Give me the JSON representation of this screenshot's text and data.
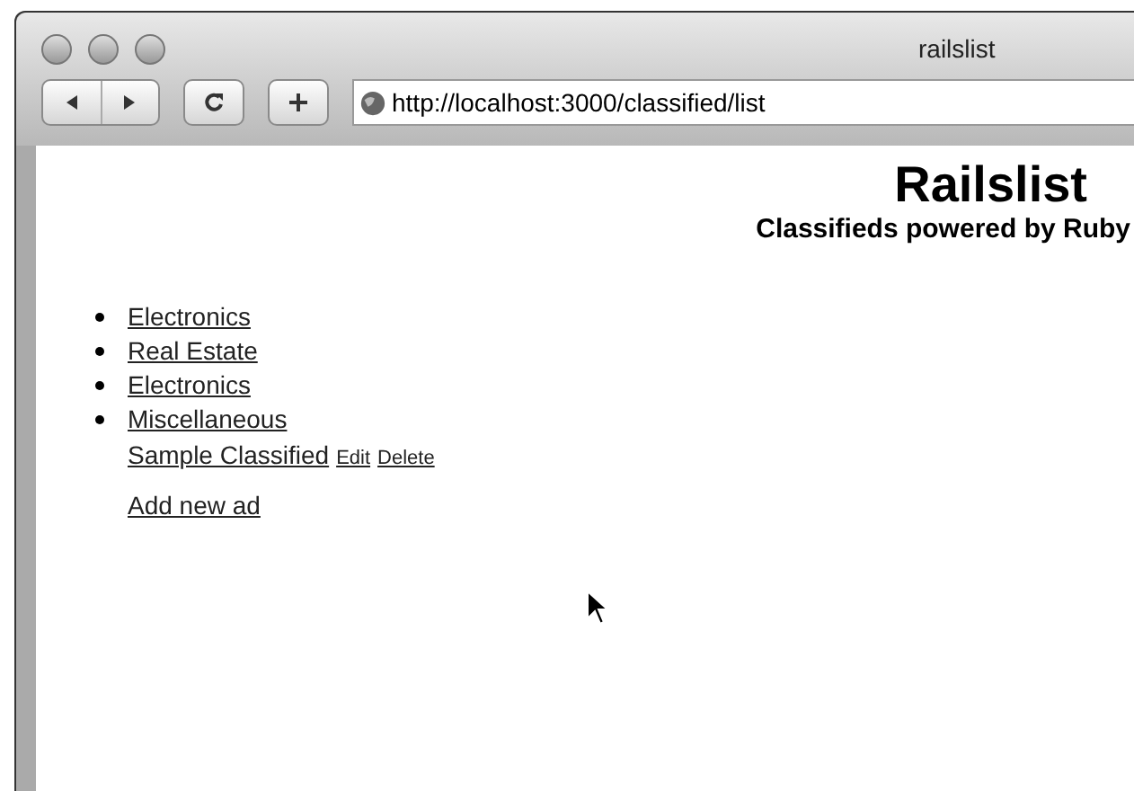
{
  "window": {
    "title": "railslist"
  },
  "toolbar": {
    "address": "http://localhost:3000/classified/list"
  },
  "page": {
    "heading": "Railslist",
    "subheading": "Classifieds powered by Ruby",
    "categories": [
      {
        "label": "Electronics"
      },
      {
        "label": "Real Estate"
      },
      {
        "label": "Electronics"
      },
      {
        "label": "Miscellaneous"
      }
    ],
    "ads": [
      {
        "title": "Sample Classified",
        "edit": "Edit",
        "delete": "Delete"
      }
    ],
    "add_link": "Add new ad"
  }
}
